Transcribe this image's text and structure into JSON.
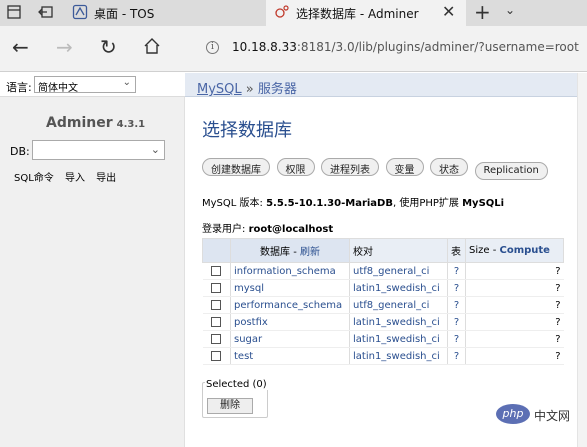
{
  "browser": {
    "tabs": [
      {
        "label": "桌面 - TOS"
      },
      {
        "label": "选择数据库 - Adminer"
      }
    ],
    "url_host": "10.18.8.33",
    "url_rest": ":8181/3.0/lib/plugins/adminer/?username=root"
  },
  "sidebar": {
    "lang_label": "语言:",
    "lang_value": "简体中文",
    "brand": "Adminer",
    "version": "4.3.1",
    "db_label": "DB:",
    "db_value": "",
    "links": [
      "SQL命令",
      "导入",
      "导出"
    ]
  },
  "header": {
    "crumb_link": "MySQL",
    "crumb_sep": "»",
    "crumb_current": "服务器"
  },
  "main": {
    "title": "选择数据库",
    "pills": [
      "创建数据库",
      "权限",
      "进程列表",
      "变量",
      "状态",
      "Replication"
    ],
    "version_prefix": "MySQL 版本:",
    "version_value": "5.5.5-10.1.30-MariaDB",
    "version_mid": ", 使用PHP扩展",
    "version_ext": "MySQLi",
    "user_prefix": "登录用户:",
    "user_value": "root@localhost",
    "table": {
      "col_db": "数据库",
      "col_db_sep": " - ",
      "col_refresh": "刷新",
      "col_collation": "校对",
      "col_tables": "表",
      "col_size": "Size",
      "col_size_sep": " - ",
      "col_compute": "Compute",
      "rows": [
        {
          "name": "information_schema",
          "collation": "utf8_general_ci",
          "tables": "?",
          "size": "?"
        },
        {
          "name": "mysql",
          "collation": "latin1_swedish_ci",
          "tables": "?",
          "size": "?"
        },
        {
          "name": "performance_schema",
          "collation": "utf8_general_ci",
          "tables": "?",
          "size": "?"
        },
        {
          "name": "postfix",
          "collation": "latin1_swedish_ci",
          "tables": "?",
          "size": "?"
        },
        {
          "name": "sugar",
          "collation": "latin1_swedish_ci",
          "tables": "?",
          "size": "?"
        },
        {
          "name": "test",
          "collation": "latin1_swedish_ci",
          "tables": "?",
          "size": "?"
        }
      ]
    },
    "selected_label": "Selected (0)",
    "delete_label": "删除"
  },
  "watermark": {
    "logo": "php",
    "text": "中文网"
  }
}
